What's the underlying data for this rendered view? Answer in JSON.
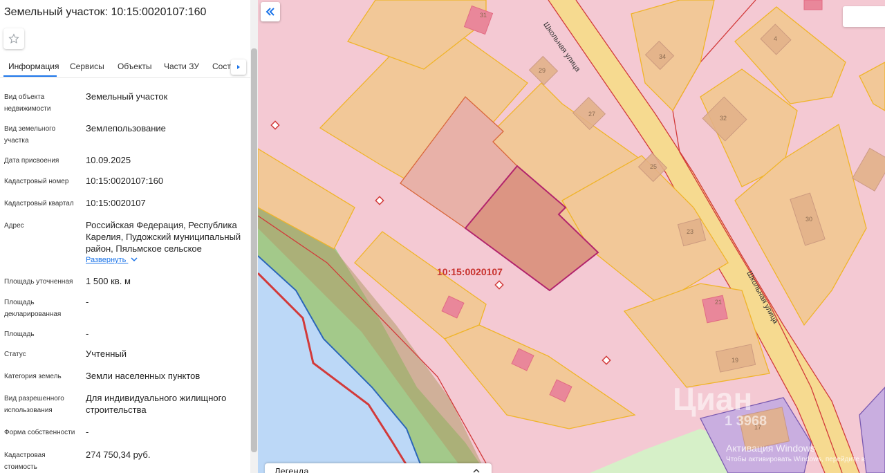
{
  "panel": {
    "title": "Земельный участок: 10:15:0020107:160",
    "tabs": [
      "Информация",
      "Сервисы",
      "Объекты",
      "Части ЗУ",
      "Соста"
    ],
    "rows": [
      {
        "label": "Вид объекта недвижимости",
        "value": "Земельный участок"
      },
      {
        "label": "Вид земельного участка",
        "value": "Землепользование"
      },
      {
        "label": "Дата присвоения",
        "value": "10.09.2025"
      },
      {
        "label": "Кадастровый номер",
        "value": "10:15:0020107:160"
      },
      {
        "label": "Кадастровый квартал",
        "value": "10:15:0020107"
      },
      {
        "label": "Адрес",
        "value": "Российская Федерация, Республика Карелия, Пудожский муниципальный район, Пяльмское сельское"
      },
      {
        "label": "Площадь уточненная",
        "value": "1 500 кв. м"
      },
      {
        "label": "Площадь декларированная",
        "value": "-"
      },
      {
        "label": "Площадь",
        "value": "-"
      },
      {
        "label": "Статус",
        "value": "Учтенный"
      },
      {
        "label": "Категория земель",
        "value": "Земли населенных пунктов"
      },
      {
        "label": "Вид разрешенного использования",
        "value": "Для индивидуального жилищного строительства"
      },
      {
        "label": "Форма собственности",
        "value": "-"
      },
      {
        "label": "Кадастровая стоимость",
        "value": "274 750,34 руб."
      }
    ],
    "expand_label": "Развернуть"
  },
  "map": {
    "quarter_label": "10:15:0020107",
    "street_label": "Школьная улица",
    "house_numbers": [
      "31",
      "29",
      "27",
      "25",
      "23",
      "34",
      "4",
      "32",
      "30",
      "21",
      "19",
      "17"
    ],
    "legend_label": "Легенда",
    "watermark_brand": "Циан",
    "watermark_id": "1 3968",
    "activation_title": "Активация Windows",
    "activation_sub": "Чтобы активировать Windows, перейдите в"
  },
  "colors": {
    "accent": "#1a73e8",
    "quarter_fill": "#f4c9d3",
    "parcel_fill": "#f2c898",
    "parcel_stroke": "#f0b429",
    "building_fill": "#e9879a",
    "selected_parcel": "#dc9583",
    "selected_stroke": "#b2246c",
    "water": "#bcd8f7",
    "forest": "#a3c98a",
    "road": "#f6dc88"
  },
  "icons": {
    "favorite": "star-icon",
    "tabs_next": "chevron-right-icon",
    "expand": "chevron-down-icon",
    "collapse_panel": "double-chevron-left-icon",
    "legend_toggle": "chevron-up-icon"
  }
}
